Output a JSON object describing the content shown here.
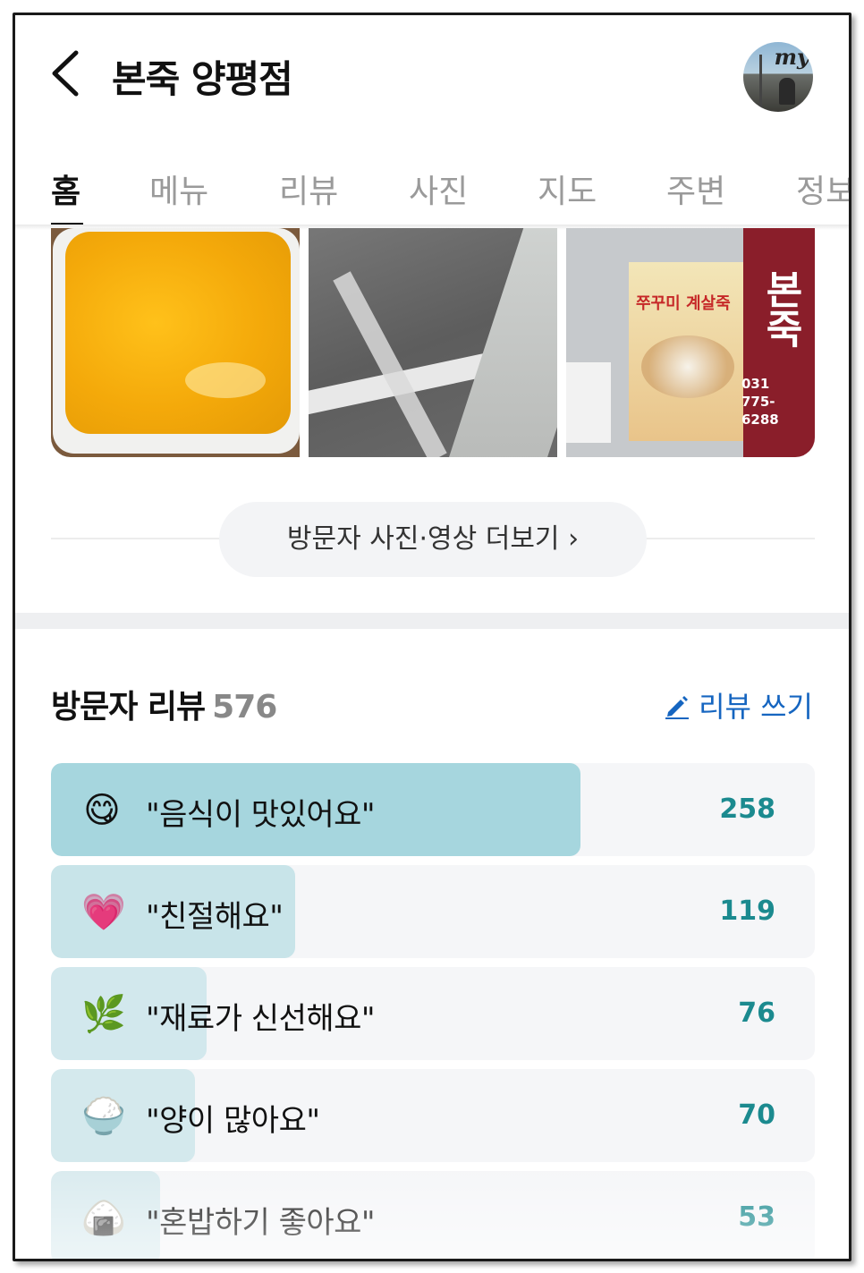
{
  "header": {
    "title": "본죽 양평점",
    "avatar_text": "my"
  },
  "tabs": [
    {
      "label": "홈",
      "active": true
    },
    {
      "label": "메뉴",
      "active": false
    },
    {
      "label": "리뷰",
      "active": false
    },
    {
      "label": "사진",
      "active": false
    },
    {
      "label": "지도",
      "active": false
    },
    {
      "label": "주변",
      "active": false
    },
    {
      "label": "정보",
      "active": false
    }
  ],
  "photos": {
    "poster_text": "쭈꾸미 계살죽",
    "sign_text": "본죽",
    "sign_phone": "031 775-6288"
  },
  "more_button": {
    "label": "방문자 사진·영상 더보기 ›"
  },
  "reviews": {
    "title": "방문자 리뷰",
    "count": "576",
    "write_label": "리뷰 쓰기",
    "accent_color": "#1565c0",
    "bar_color": "#a6d6de",
    "count_color": "#1b8a8f",
    "max": 258,
    "keywords": [
      {
        "icon": "yum-face-icon",
        "emoji": "😋",
        "label": "\"음식이 맛있어요\"",
        "count": 258
      },
      {
        "icon": "heart-icon",
        "emoji": "💗",
        "label": "\"친절해요\"",
        "count": 119
      },
      {
        "icon": "leaf-icon",
        "emoji": "🌿",
        "label": "\"재료가 신선해요\"",
        "count": 76
      },
      {
        "icon": "rice-bowl-icon",
        "emoji": "🍚",
        "label": "\"양이 많아요\"",
        "count": 70
      },
      {
        "icon": "rice-ball-icon",
        "emoji": "🍙",
        "label": "\"혼밥하기 좋아요\"",
        "count": 53
      }
    ]
  }
}
